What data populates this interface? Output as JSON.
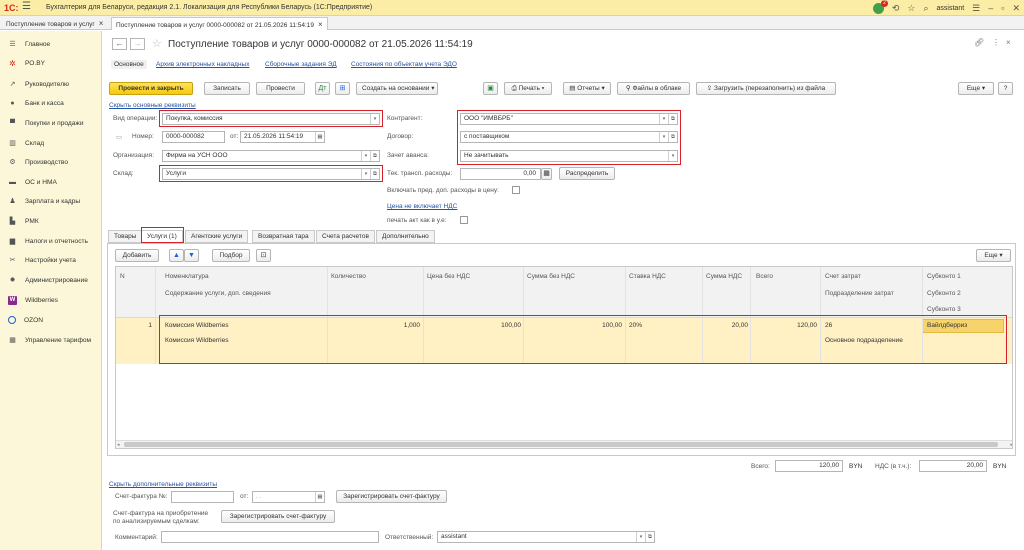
{
  "app": {
    "logo": "1С:",
    "title": "Бухгалтерия для Беларуси, редакция 2.1. Локализация для Республики Беларусь   (1С:Предприятие)",
    "user": "assistant",
    "notifications": "2"
  },
  "tabs": [
    {
      "label": "Поступление товаров и услуг"
    },
    {
      "label": "Поступление товаров и услуг 0000-000082 от 21.05.2026 11:54:19"
    }
  ],
  "sidebar": {
    "items": [
      {
        "label": "Главное",
        "icon": "menu-lines-icon"
      },
      {
        "label": "РО.BY",
        "icon": "star-icon"
      },
      {
        "label": "Руководителю",
        "icon": "chart-icon"
      },
      {
        "label": "Банк и касса",
        "icon": "bank-icon"
      },
      {
        "label": "Покупки и продажи",
        "icon": "cart-icon"
      },
      {
        "label": "Склад",
        "icon": "warehouse-icon"
      },
      {
        "label": "Производство",
        "icon": "gear-icon"
      },
      {
        "label": "ОС и НМА",
        "icon": "car-icon"
      },
      {
        "label": "Зарплата и кадры",
        "icon": "person-icon"
      },
      {
        "label": "РМК",
        "icon": "cash-register-icon"
      },
      {
        "label": "Налоги и отчетность",
        "icon": "bar-chart-icon"
      },
      {
        "label": "Настройки учета",
        "icon": "tools-icon"
      },
      {
        "label": "Администрирование",
        "icon": "settings-icon"
      },
      {
        "label": "Wildberries",
        "icon": "wildberries-icon"
      },
      {
        "label": "OZON",
        "icon": "ozon-icon"
      },
      {
        "label": "Управление тарифом",
        "icon": "grid-icon"
      }
    ]
  },
  "doc": {
    "title": "Поступление товаров и услуг 0000-000082 от 21.05.2026 11:54:19",
    "link_tabs": [
      "Основное",
      "Архив электронных накладных",
      "Сборочные задания ЭД",
      "Состояния по объектам учета ЭДО"
    ],
    "buttons": {
      "post_close": "Провести и закрыть",
      "write": "Записать",
      "post": "Провести",
      "create_based": "Создать на основании",
      "print": "Печать",
      "reports": "Отчеты",
      "cloud_files": "Файлы в облаке",
      "load_file": "Загрузить (перезаполнить) из файла",
      "more": "Еще",
      "help": "?"
    },
    "hide_main": "Скрыть основные реквизиты",
    "fields": {
      "operation_label": "Вид операции:",
      "operation_value": "Покупка, комиссия",
      "number_label": "Номер:",
      "number_value": "0000-000082",
      "date_label": "от:",
      "date_value": "21.05.2026 11:54:19",
      "org_label": "Организация:",
      "org_value": "Фирма на УСН ООО",
      "warehouse_label": "Склад:",
      "warehouse_value": "Услуги",
      "counterparty_label": "Контрагент:",
      "counterparty_value": "ООО \"ИМВБРБ\"",
      "contract_label": "Договор:",
      "contract_value": "с поставщиком",
      "advance_label": "Зачет аванса:",
      "advance_value": "Не зачитывать",
      "transport_label": "Тек. трансп. расходы:",
      "transport_value": "0,00",
      "distribute": "Распределить",
      "include_label": "Включать пред. доп. расходы в цену:",
      "vat_link": "Цена не включает НДС",
      "print_act_label": "печать акт как в у.е:"
    },
    "form_tabs": [
      "Товары",
      "Услуги (1)",
      "Агентские услуги",
      "Возвратная тара",
      "Счета расчетов",
      "Дополнительно"
    ],
    "table_toolbar": {
      "add": "Добавить",
      "pick": "Подбор",
      "more": "Еще"
    },
    "table": {
      "headers": {
        "n": "N",
        "nomenclature": "Номенклатура",
        "content": "Содержание услуги, доп. сведения",
        "qty": "Количество",
        "price": "Цена без НДС",
        "sum": "Сумма без НДС",
        "rate": "Ставка НДС",
        "vat": "Сумма НДС",
        "total": "Всего",
        "account": "Счет затрат",
        "department": "Подразделение затрат",
        "sub1": "Субконто 1",
        "sub2": "Субконто 2",
        "sub3": "Субконто 3"
      },
      "rows": [
        {
          "n": "1",
          "nomenclature": "Комиссия Wildberries",
          "content": "Комиссия Wildberries",
          "qty": "1,000",
          "price": "100,00",
          "sum": "100,00",
          "rate": "20%",
          "vat": "20,00",
          "total": "120,00",
          "account": "26",
          "department": "Основное подразделение",
          "sub1": "Вайлдберриз"
        }
      ]
    },
    "totals": {
      "total_label": "Всего:",
      "total_value": "120,00",
      "currency1": "BYN",
      "vat_label": "НДС (в т.ч.):",
      "vat_value": "20,00",
      "currency2": "BYN"
    },
    "footer": {
      "hide_extra": "Скрыть дополнительные реквизиты",
      "invoice_label": "Счет-фактура №:",
      "invoice_from": "от:",
      "invoice_date_placeholder": ". .",
      "register_invoice": "Зарегистрировать счет-фактуру",
      "invoice_unanalyzed_label1": "Счет-фактура на приобретение",
      "invoice_unanalyzed_label2": "по анализируемым сделкам:",
      "register_invoice2": "Зарегистрировать счет-фактуру",
      "comment_label": "Комментарий:",
      "responsible_label": "Ответственный:",
      "responsible_value": "assistant"
    }
  }
}
